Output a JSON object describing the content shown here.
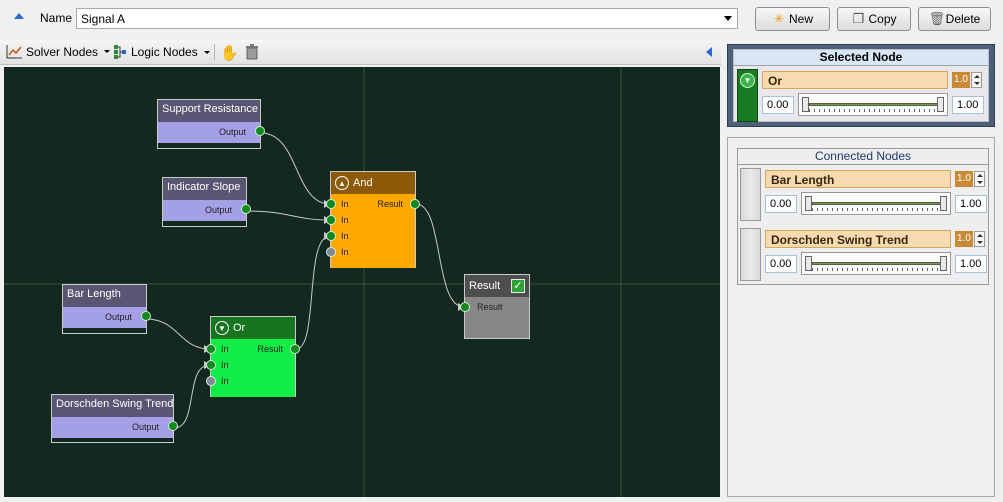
{
  "header": {
    "name_label": "Name",
    "name_value": "Signal A",
    "buttons": {
      "new": "New",
      "copy": "Copy",
      "delete": "Delete"
    }
  },
  "toolbar": {
    "solver_nodes": "Solver Nodes",
    "logic_nodes": "Logic Nodes"
  },
  "canvas": {
    "sources": [
      {
        "title": "Support Resistance",
        "output": "Output"
      },
      {
        "title": "Indicator Slope",
        "output": "Output"
      },
      {
        "title": "Bar Length",
        "output": "Output"
      },
      {
        "title": "Dorschden Swing Trend",
        "output": "Output"
      }
    ],
    "and_node": {
      "title": "And",
      "inputs": [
        "In",
        "In",
        "In",
        "In"
      ],
      "output": "Result"
    },
    "or_node": {
      "title": "Or",
      "inputs": [
        "In",
        "In",
        "In"
      ],
      "output": "Result"
    },
    "result_node": {
      "title": "Result",
      "input": "Result"
    }
  },
  "selected": {
    "title": "Selected Node",
    "name": "Or",
    "weight": "1.0",
    "min": "0.00",
    "max": "1.00",
    "slider_level": 1.0
  },
  "connected": {
    "title": "Connected Nodes",
    "items": [
      {
        "name": "Bar Length",
        "weight": "1.0",
        "min": "0.00",
        "max": "1.00",
        "slider_level": 1.0
      },
      {
        "name": "Dorschden Swing Trend",
        "weight": "1.0",
        "min": "0.00",
        "max": "1.00",
        "slider_level": 1.0
      }
    ]
  },
  "colors": {
    "canvas_bg": "#13291f",
    "source_node": "#a4a0e6",
    "and_node": "#ffa800",
    "or_node": "#10ed47",
    "result_node": "#878787",
    "port": "#118a1d",
    "wire": "#c8c8c8"
  }
}
